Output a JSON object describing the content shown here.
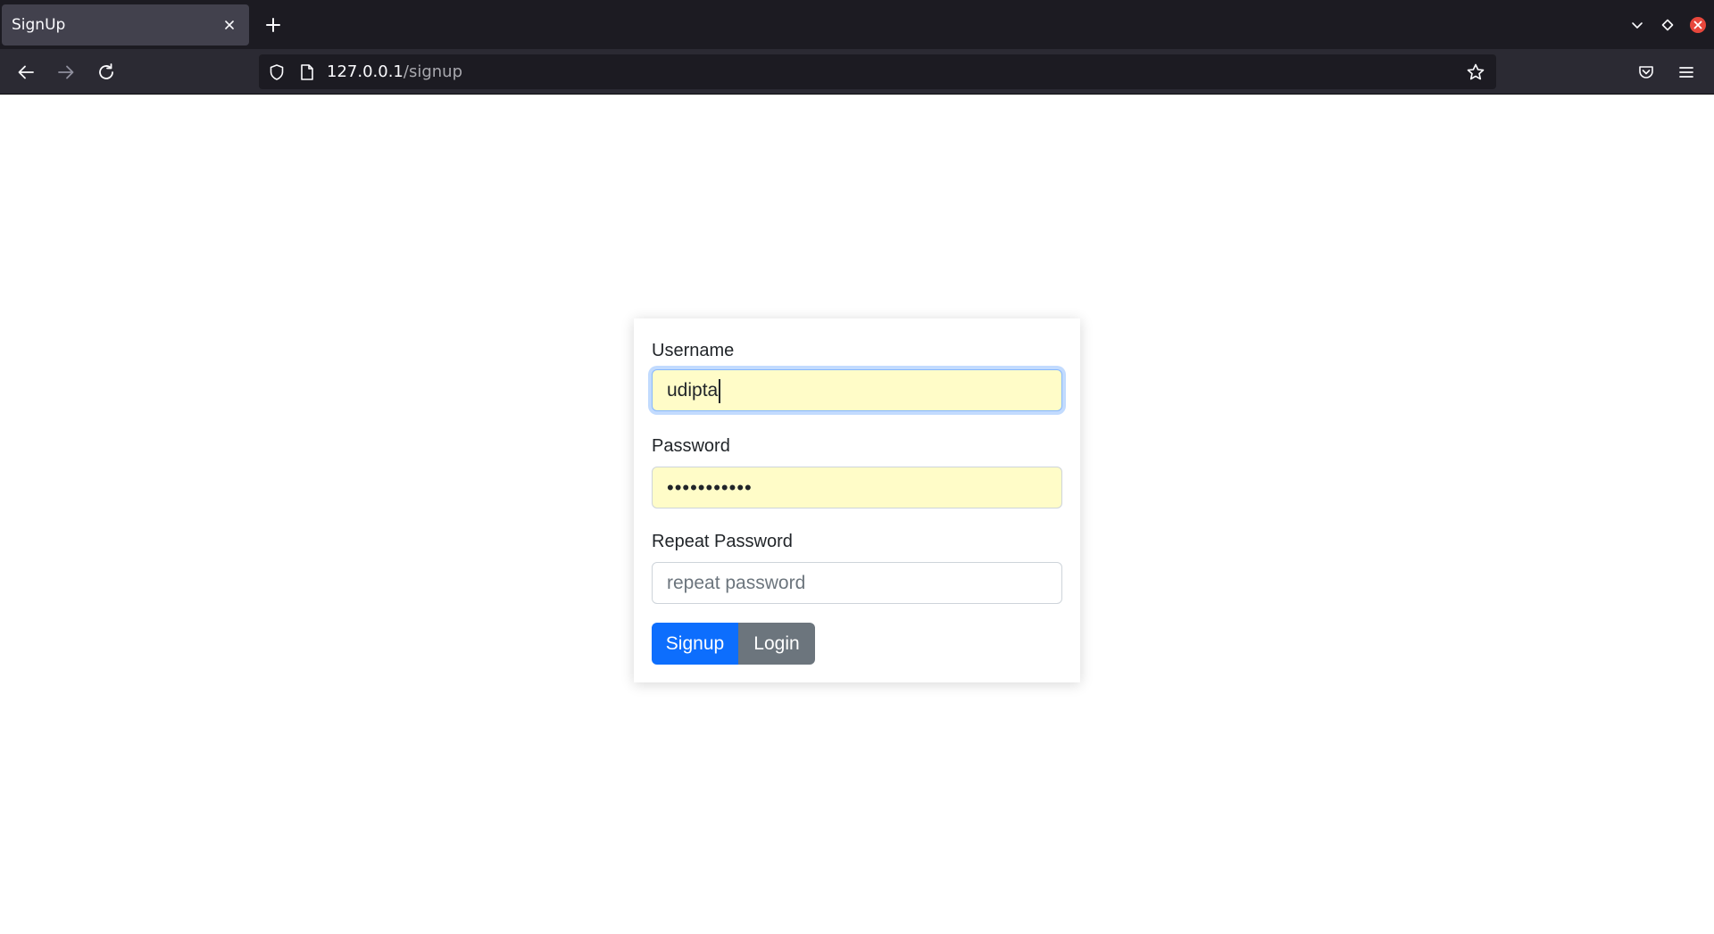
{
  "browser": {
    "tab": {
      "title": "SignUp"
    },
    "url": {
      "host": "127.0.0.1",
      "path": "/signup"
    }
  },
  "form": {
    "username": {
      "label": "Username",
      "value": "udipta"
    },
    "password": {
      "label": "Password",
      "masked_value": "•••••••••••"
    },
    "repeat_password": {
      "label": "Repeat Password",
      "placeholder": "repeat password"
    },
    "buttons": {
      "signup": "Signup",
      "login": "Login"
    }
  },
  "colors": {
    "primary": "#0d6efd",
    "secondary": "#6c757d",
    "autofill": "#fffcc8",
    "firefox_close": "#e8473c"
  }
}
